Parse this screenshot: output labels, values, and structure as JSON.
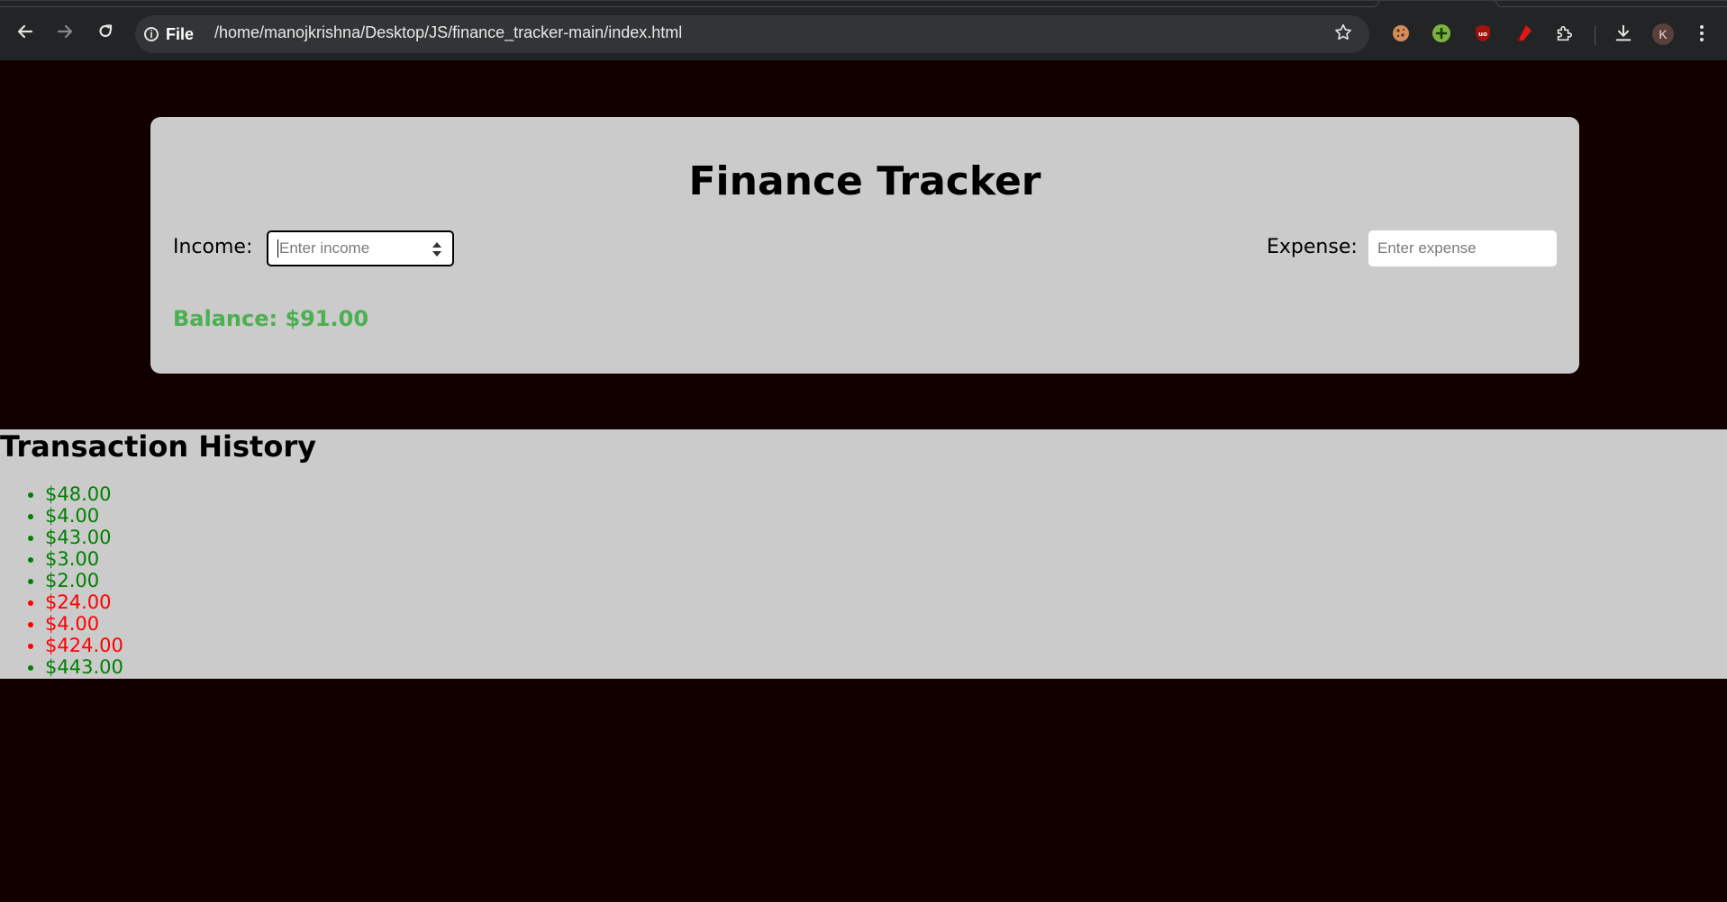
{
  "browser": {
    "site_label": "File",
    "url": "/home/manojkrishna/Desktop/JS/finance_tracker-main/index.html",
    "profile_initial": "K"
  },
  "app": {
    "title": "Finance Tracker",
    "income_label": "Income:",
    "income_placeholder": "Enter income",
    "expense_label": "Expense:",
    "expense_placeholder": "Enter expense",
    "balance_text": "Balance: $91.00",
    "history_title": "Transaction History",
    "transactions": [
      {
        "amount": "$48.00",
        "type": "income"
      },
      {
        "amount": "$4.00",
        "type": "income"
      },
      {
        "amount": "$43.00",
        "type": "income"
      },
      {
        "amount": "$3.00",
        "type": "income"
      },
      {
        "amount": "$2.00",
        "type": "income"
      },
      {
        "amount": "$24.00",
        "type": "expense"
      },
      {
        "amount": "$4.00",
        "type": "expense"
      },
      {
        "amount": "$424.00",
        "type": "expense"
      },
      {
        "amount": "$443.00",
        "type": "income"
      }
    ]
  },
  "colors": {
    "page_background": "#120000",
    "panel": "#cbcbcb",
    "income": "#008000",
    "expense": "#ff0000",
    "balance": "#4caf50"
  }
}
